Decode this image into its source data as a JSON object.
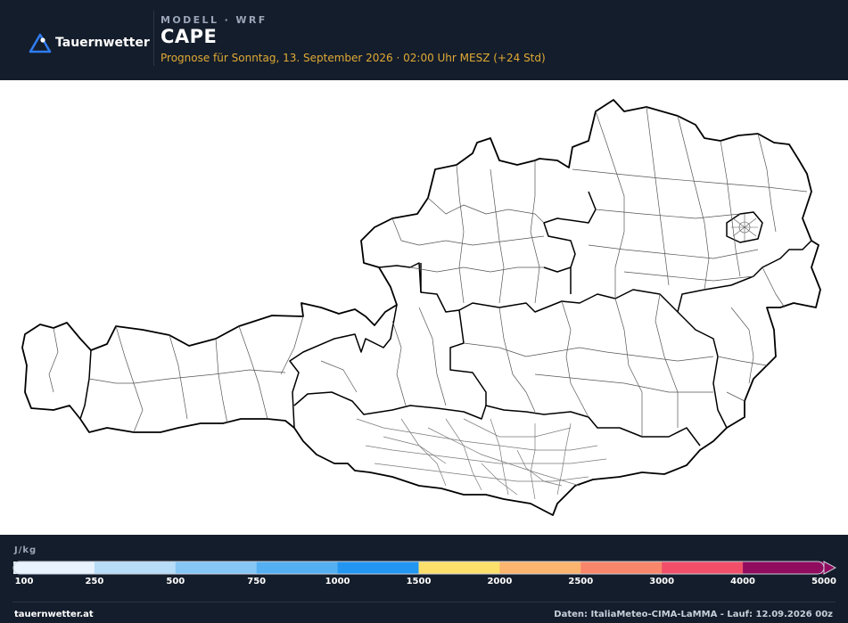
{
  "header": {
    "brand": "Tauernwetter",
    "model_label": "MODELL · WRF",
    "title": "CAPE",
    "subtitle": "Prognose für Sonntag, 13. September 2026 · 02:00 Uhr MESZ  (+24 Std)"
  },
  "legend": {
    "unit": "J/kg",
    "ticks": [
      "100",
      "250",
      "500",
      "750",
      "1000",
      "1500",
      "2000",
      "2500",
      "3000",
      "4000",
      "5000"
    ],
    "colors": [
      "#e8f3fd",
      "#b7ddf9",
      "#86c7f6",
      "#55b0f3",
      "#2296f1",
      "#fde06c",
      "#fbb56e",
      "#f8866a",
      "#f14f69",
      "#900c5f"
    ]
  },
  "footer": {
    "site": "tauernwetter.at",
    "credits": "Daten: ItaliaMeteo-CIMA-LaMMA - Lauf: 12.09.2026 00z"
  },
  "map": {
    "region": "Österreich",
    "highlight_color": "#ffffff",
    "border_color": "#000000"
  }
}
